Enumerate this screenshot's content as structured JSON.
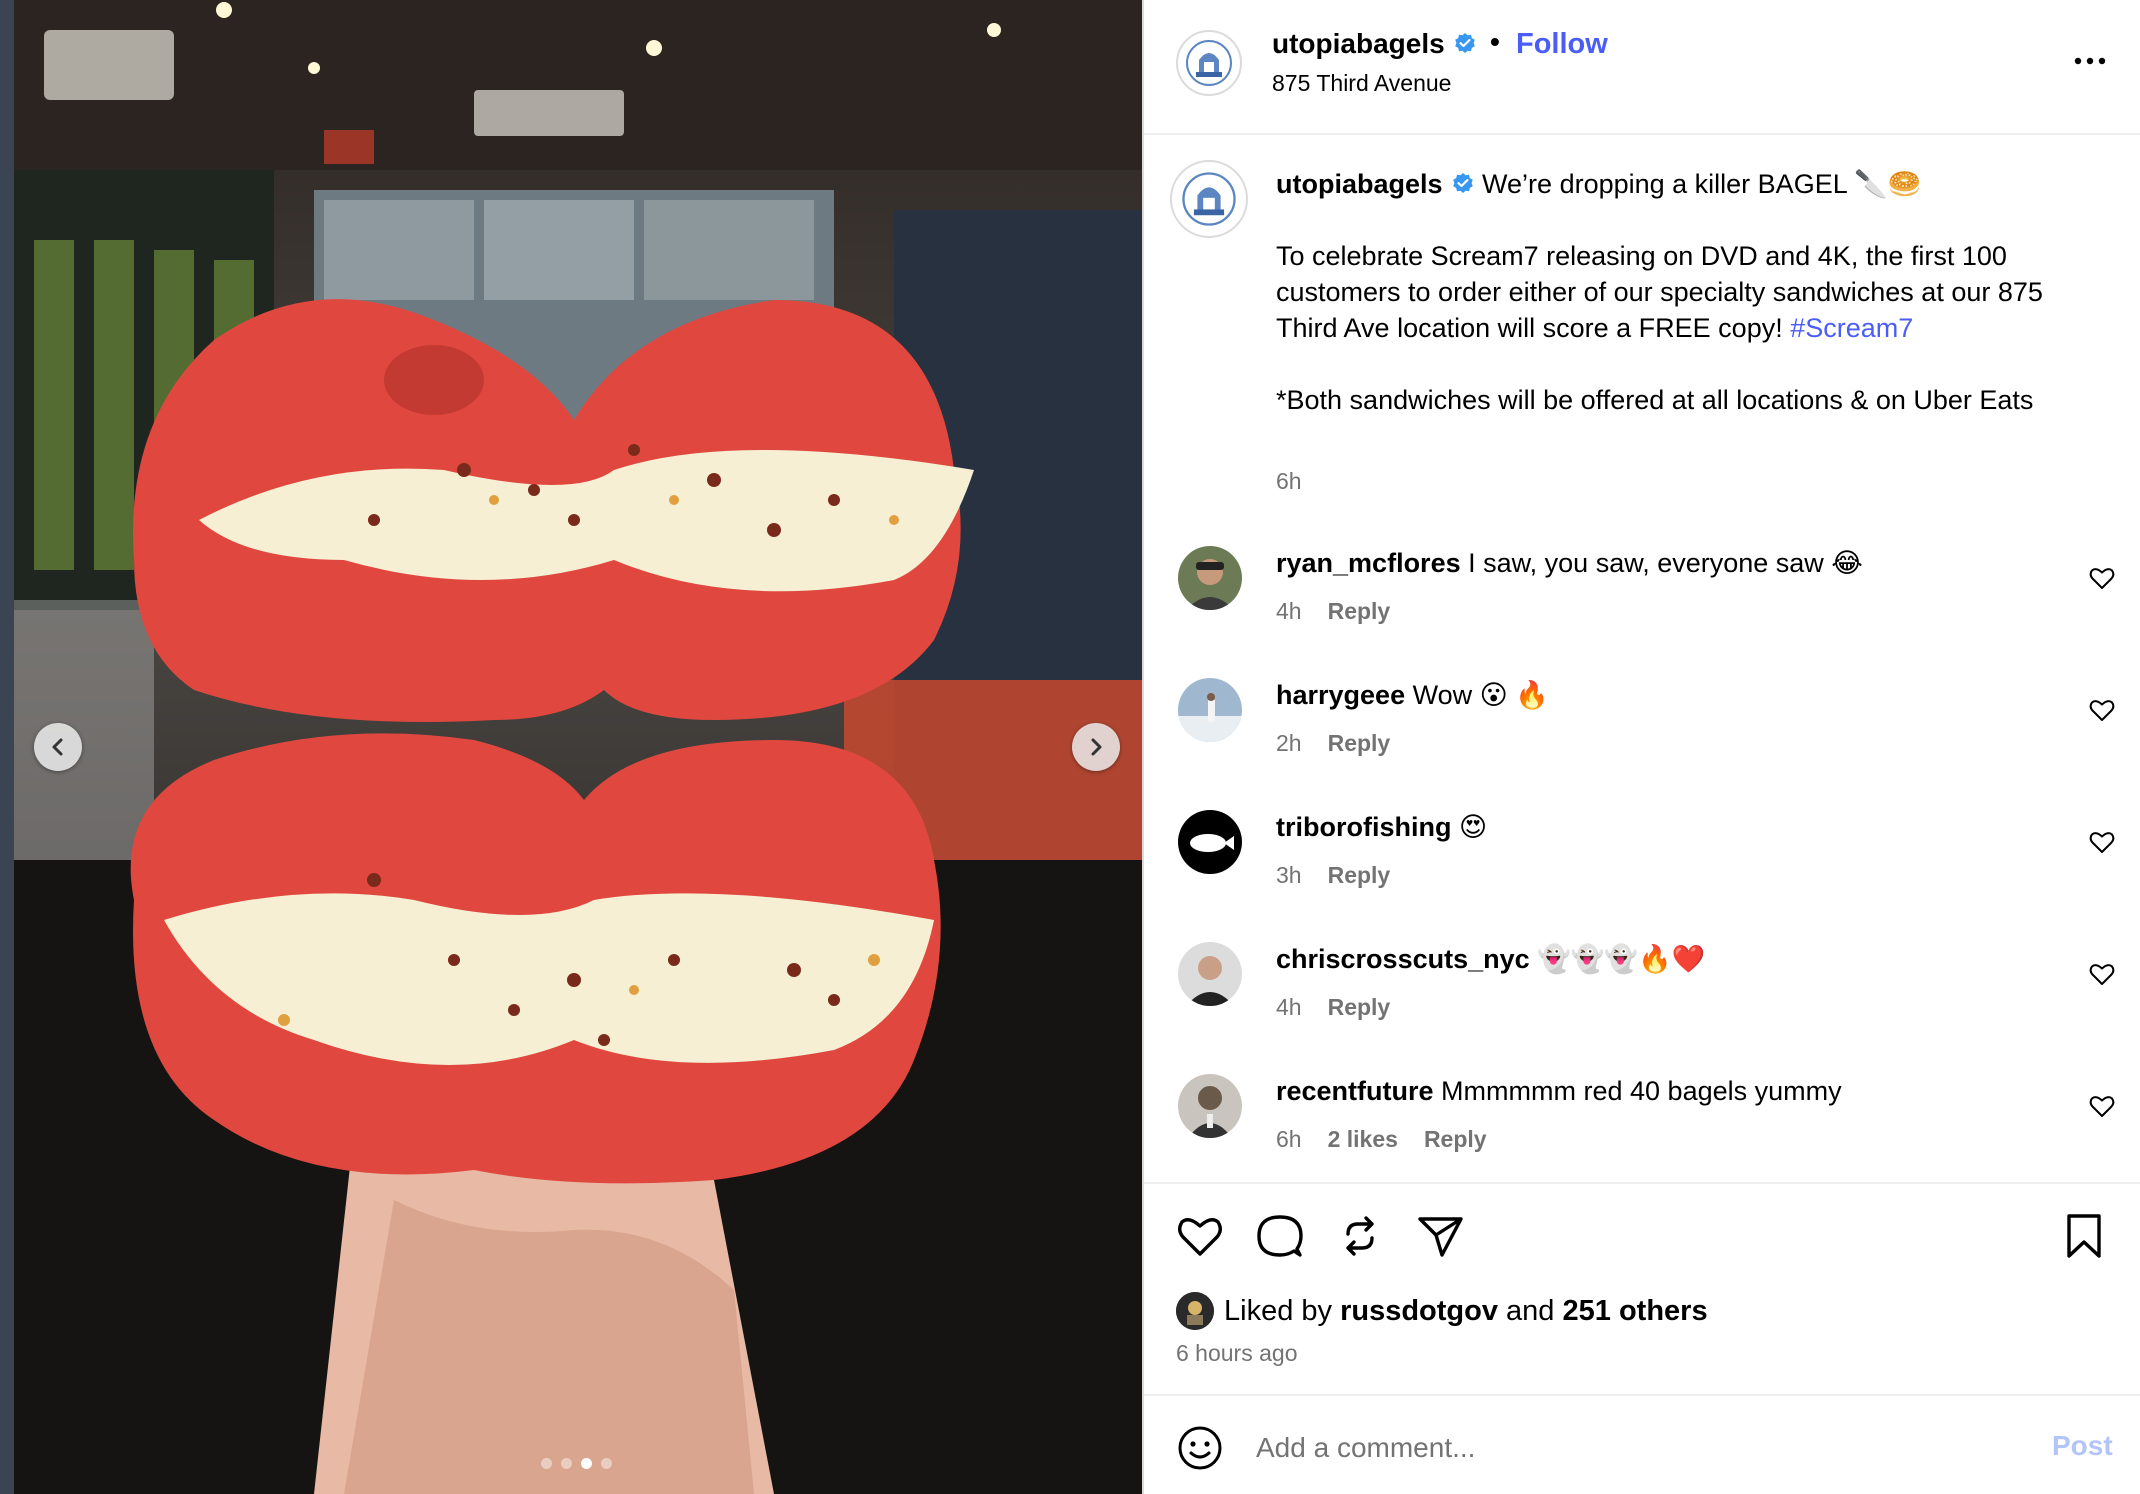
{
  "header": {
    "username": "utopiabagels",
    "separator": "•",
    "follow_label": "Follow",
    "location": "875 Third Avenue",
    "avatar_icon": "utopia-bagels-logo-icon",
    "more_icon": "more-options-icon"
  },
  "media": {
    "slide_count": 4,
    "active_slide": 3,
    "prev_icon": "chevron-left-icon",
    "next_icon": "chevron-right-icon"
  },
  "caption": {
    "username": "utopiabagels",
    "line1": "We’re dropping a killer BAGEL 🔪🥯",
    "para2": "To celebrate Scream7 releasing on DVD and 4K, the first 100 customers to order either of our specialty sandwiches at our 875 Third Ave location will score a FREE copy!",
    "hashtag": "#Scream7",
    "para3": "*Both sandwiches will be offered at all locations & on Uber Eats",
    "time": "6h"
  },
  "comments": [
    {
      "username": "ryan_mcflores",
      "text": "I saw, you saw, everyone saw 😂",
      "time": "4h",
      "likes": "",
      "reply": "Reply"
    },
    {
      "username": "harrygeee",
      "text": "Wow 😮 🔥",
      "time": "2h",
      "likes": "",
      "reply": "Reply"
    },
    {
      "username": "triborofishing",
      "text": "😍",
      "time": "3h",
      "likes": "",
      "reply": "Reply"
    },
    {
      "username": "chriscrosscuts_nyc",
      "text": "👻👻👻🔥❤️",
      "time": "4h",
      "likes": "",
      "reply": "Reply"
    },
    {
      "username": "recentfuture",
      "text": "Mmmmmm red 40 bagels yummy",
      "time": "6h",
      "likes": "2 likes",
      "reply": "Reply"
    }
  ],
  "likes": {
    "prefix": "Liked by",
    "user": "russdotgov",
    "and": "and",
    "others": "251 others"
  },
  "posted": "6 hours ago",
  "add_comment": {
    "placeholder": "Add a comment...",
    "post_label": "Post"
  },
  "colors": {
    "link_blue": "#4a5df9",
    "post_disabled": "#b3c5f8",
    "muted": "#737373",
    "bagel_red": "#e0483f"
  }
}
